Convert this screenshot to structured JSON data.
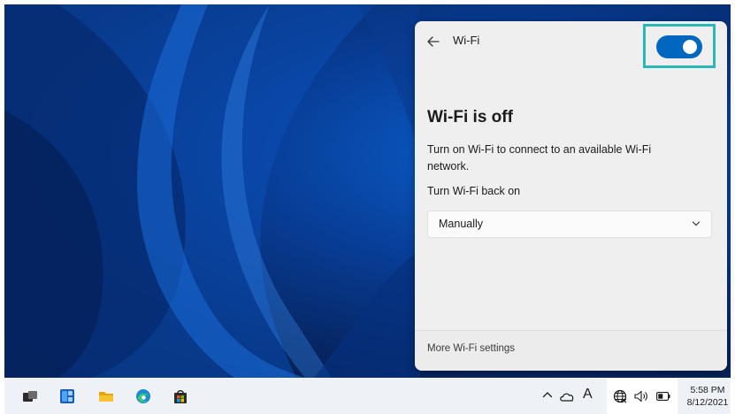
{
  "colors": {
    "accent": "#0067c0",
    "highlight": "#2ab7b7",
    "desktop": "#083e98"
  },
  "flyout": {
    "header_title": "Wi-Fi",
    "back_icon": "arrow-left-icon",
    "toggle_state": "on",
    "heading": "Wi-Fi is off",
    "description": "Turn on Wi-Fi to connect to an available Wi-Fi network.",
    "turn_back_on_label": "Turn Wi-Fi back on",
    "turn_back_on_value": "Manually",
    "footer_link": "More Wi-Fi settings"
  },
  "taskbar": {
    "apps": [
      "task-view-icon",
      "widgets-icon",
      "file-explorer-icon",
      "edge-icon",
      "store-icon"
    ],
    "tray": {
      "ime": "A",
      "icons": [
        "chevron-up-icon",
        "onedrive-icon",
        "globe-icon",
        "volume-icon",
        "battery-icon"
      ]
    },
    "clock": {
      "time": "5:58 PM",
      "date": "8/12/2021"
    }
  }
}
